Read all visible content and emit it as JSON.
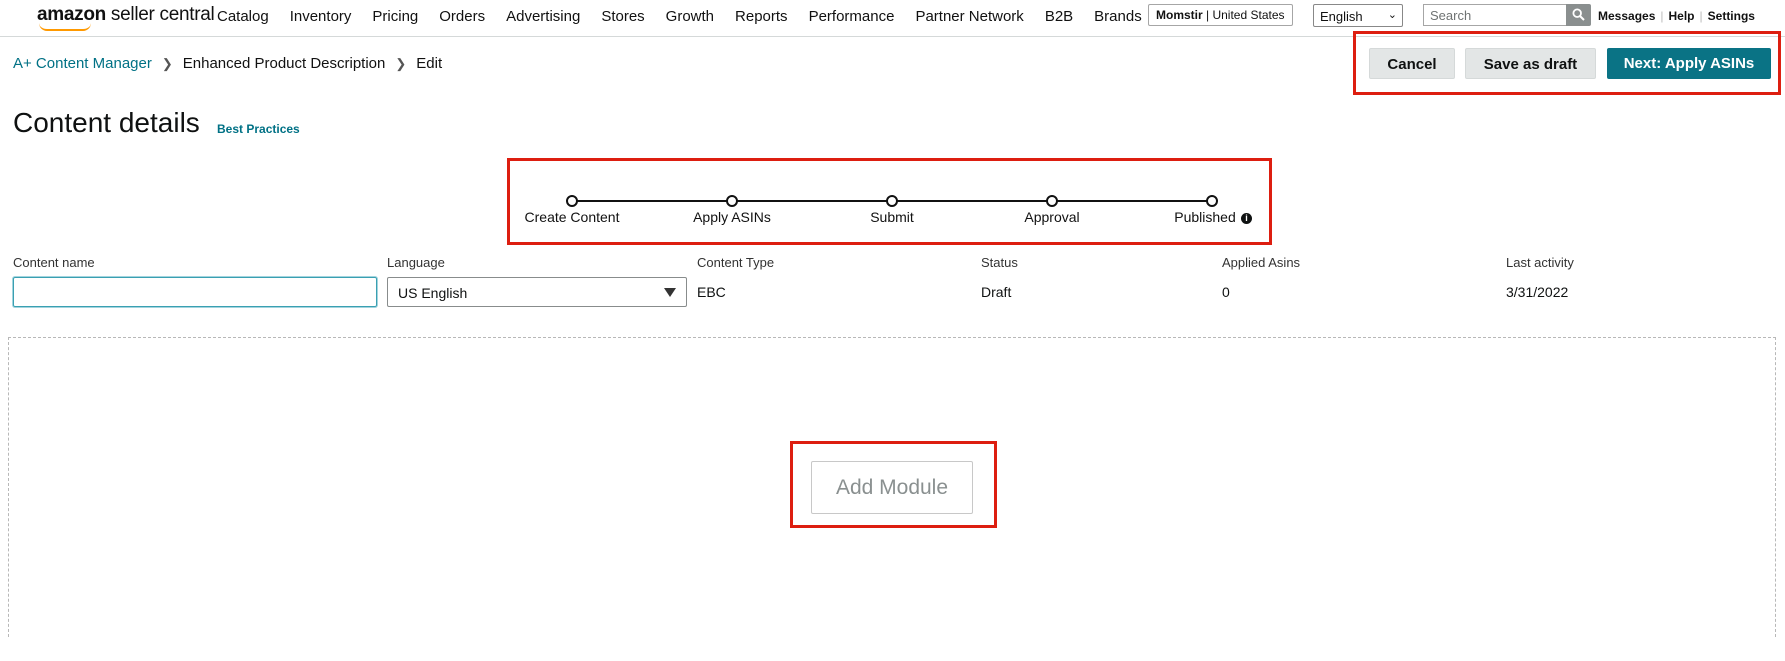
{
  "brand": {
    "logo_bold": "amazon",
    "logo_rest": " seller central",
    "accent": "#ff9900"
  },
  "nav": {
    "items": [
      "Catalog",
      "Inventory",
      "Pricing",
      "Orders",
      "Advertising",
      "Stores",
      "Growth",
      "Reports",
      "Performance",
      "Partner Network",
      "B2B",
      "Brands"
    ],
    "account_store": "Momstir",
    "account_region": "United States",
    "language": "English",
    "search_placeholder": "Search",
    "search_icon": "search-icon",
    "util": [
      "Messages",
      "Help",
      "Settings"
    ]
  },
  "breadcrumb": {
    "items": [
      "A+ Content Manager",
      "Enhanced Product Description",
      "Edit"
    ]
  },
  "actions": {
    "cancel": "Cancel",
    "save_draft": "Save as draft",
    "next": "Next: Apply ASINs",
    "primary_color": "#0a7385"
  },
  "page": {
    "title": "Content details",
    "best_practices": "Best Practices"
  },
  "stepper": {
    "steps": [
      "Create Content",
      "Apply ASINs",
      "Submit",
      "Approval",
      "Published"
    ],
    "info_icon": "info-icon"
  },
  "details": {
    "content_name_label": "Content name",
    "content_name_value": "",
    "language_label": "Language",
    "language_value": "US English",
    "content_type_label": "Content Type",
    "content_type_value": "EBC",
    "status_label": "Status",
    "status_value": "Draft",
    "applied_asins_label": "Applied Asins",
    "applied_asins_value": "0",
    "last_activity_label": "Last activity",
    "last_activity_value": "3/31/2022"
  },
  "module": {
    "add_label": "Add Module"
  },
  "highlight_color": "#dd1e10"
}
